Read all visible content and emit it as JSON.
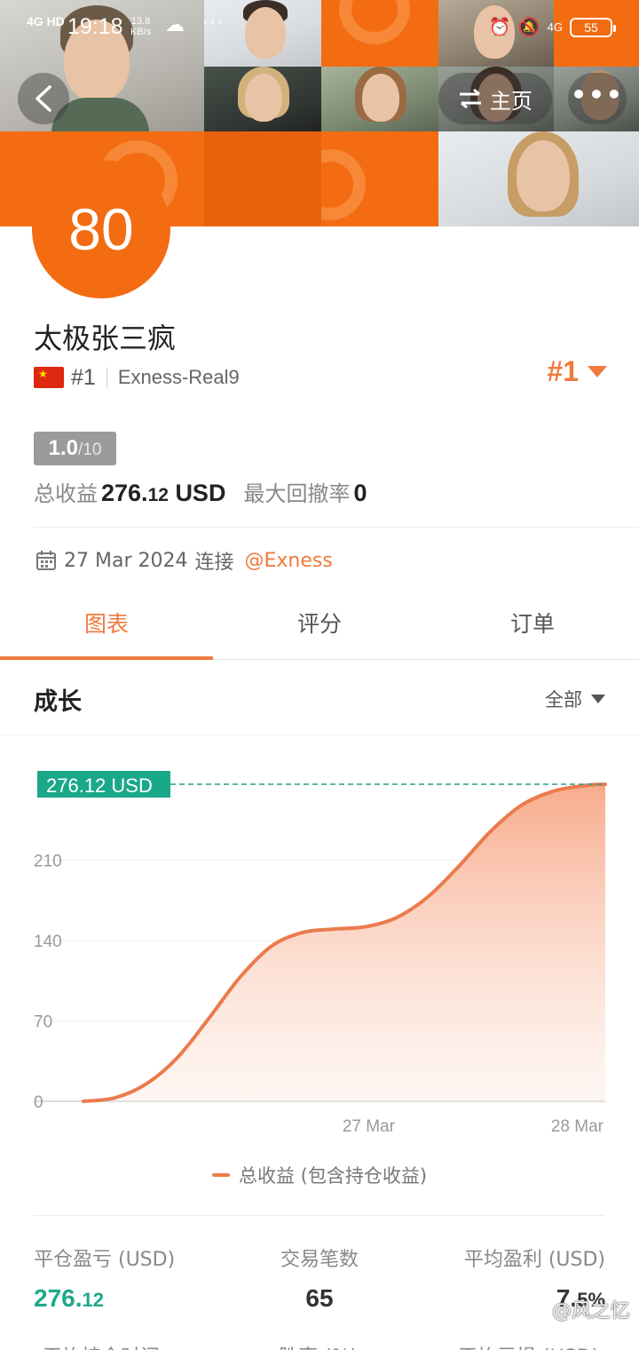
{
  "status_bar": {
    "network": "4G HD",
    "time": "19:18",
    "speed_value": "13.8",
    "speed_unit": "KB/s",
    "more": "···",
    "net_right": "4G",
    "battery": "55"
  },
  "header": {
    "home_label": "主页",
    "score": "80"
  },
  "profile": {
    "name": "太极张三疯",
    "rank": "#1",
    "server": "Exness-Real9",
    "rank_right": "#1",
    "rating_value": "1.0",
    "rating_max": "/10",
    "total_profit_label": "总收益",
    "total_profit_int": "276.",
    "total_profit_dec": "12",
    "total_profit_unit": "USD",
    "max_drawdown_label": "最大回撤率",
    "max_drawdown_value": "0",
    "connect_date": "27 Mar 2024",
    "connect_label": "连接",
    "connect_link": "@Exness"
  },
  "tabs": [
    {
      "label": "图表"
    },
    {
      "label": "评分"
    },
    {
      "label": "订单"
    }
  ],
  "section": {
    "title": "成长",
    "filter": "全部"
  },
  "colors": {
    "brand": "#f36c12",
    "accent": "#f07a3d",
    "line": "#ea7b4d",
    "highlight": "#1aa88a"
  },
  "chart_data": {
    "type": "area",
    "x": [
      "27 Mar",
      "28 Mar"
    ],
    "xticks": [
      "27 Mar",
      "28 Mar"
    ],
    "yticks": [
      0,
      70,
      140,
      210
    ],
    "ylim": [
      0,
      280
    ],
    "series": [
      {
        "name": "总收益 (包含持仓收益)",
        "points": [
          [
            0.0,
            0
          ],
          [
            0.06,
            3
          ],
          [
            0.12,
            15
          ],
          [
            0.18,
            38
          ],
          [
            0.24,
            72
          ],
          [
            0.3,
            108
          ],
          [
            0.36,
            135
          ],
          [
            0.42,
            147
          ],
          [
            0.48,
            150
          ],
          [
            0.54,
            152
          ],
          [
            0.6,
            160
          ],
          [
            0.66,
            178
          ],
          [
            0.72,
            205
          ],
          [
            0.78,
            235
          ],
          [
            0.84,
            258
          ],
          [
            0.9,
            270
          ],
          [
            0.96,
            275
          ],
          [
            1.0,
            276.12
          ]
        ]
      }
    ],
    "last_value_label": "276.12 USD",
    "legend": "top-center below axis"
  },
  "legend_label": "总收益 (包含持仓收益)",
  "stats": {
    "closed_pnl_label": "平仓盈亏 (USD)",
    "closed_pnl_int": "276.",
    "closed_pnl_dec": "12",
    "trades_label": "交易笔数",
    "trades_value": "65",
    "avg_profit_label": "平均盈利 (USD)",
    "avg_profit_int": "7.",
    "avg_profit_dec": "5%",
    "row2_label1": "平均持仓时间",
    "row2_label2": "胜率 (%)",
    "row2_label3": "平均亏损 (USD)"
  },
  "watermark": "@风之忆"
}
